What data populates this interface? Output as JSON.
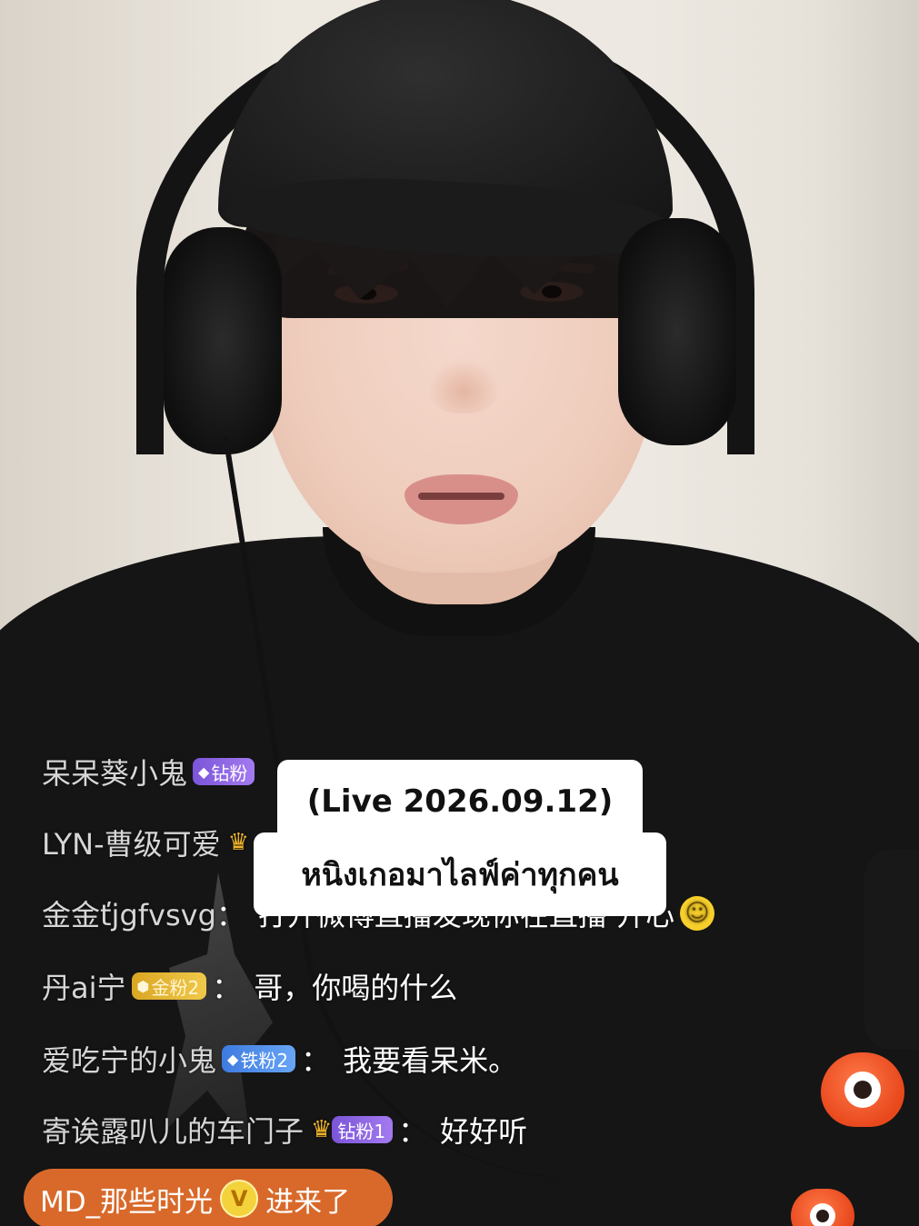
{
  "caption": {
    "line1": "(Live 2026.09.12)",
    "line2": "หนิงเกอมาไลฟ์ค่าทุกคน"
  },
  "chat": [
    {
      "user": "呆呆葵小鬼",
      "badge": "钻粉",
      "badge_color": "#8e66e6",
      "message": ""
    },
    {
      "user": "LYN-曹级可爱",
      "badge": "",
      "message": ""
    },
    {
      "user": "金金ťjgfvsvg",
      "badge": "",
      "message": "打开微博直播发现你在直播 开心",
      "emoji": "smile-emoji"
    },
    {
      "user": "丹ai宁",
      "badge": "金粉2",
      "badge_color": "#e1b033",
      "message": "哥，你喝的什么"
    },
    {
      "user": "爱吃宁的小鬼",
      "badge": "铁粉2",
      "badge_color": "#4a8ae8",
      "message": "我要看呆米。"
    },
    {
      "user": "寄诶露叭儿的车门子",
      "badge": "钻粉1",
      "badge_color": "#8e66e6",
      "message": "好好听"
    }
  ],
  "entry_notice": {
    "user": "MD_那些时光",
    "vip_label": "V",
    "action": "进来了",
    "color": "#d9692a"
  },
  "icons": {
    "mascot": "live-mascot-icon",
    "crown": "crown-icon"
  }
}
